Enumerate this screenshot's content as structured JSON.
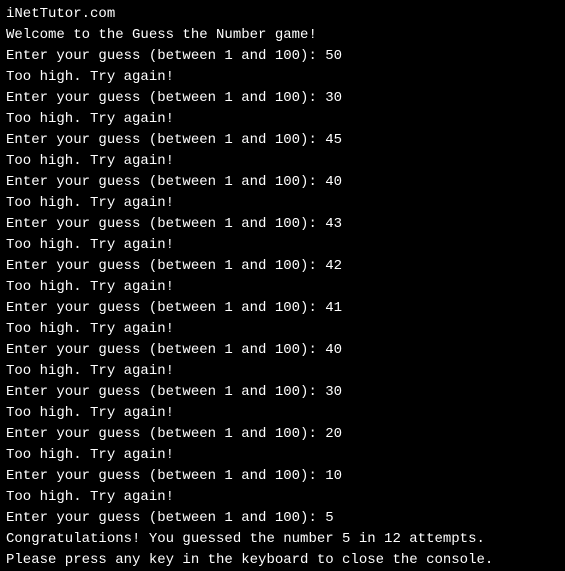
{
  "console": {
    "header": "iNetTutor.com",
    "welcome": "Welcome to the Guess the Number game!",
    "prompt_prefix": "Enter your guess (between 1 and 100): ",
    "feedback_high": "Too high. Try again!",
    "attempts": [
      {
        "guess": "50",
        "feedback": "Too high. Try again!"
      },
      {
        "guess": "30",
        "feedback": "Too high. Try again!"
      },
      {
        "guess": "45",
        "feedback": "Too high. Try again!"
      },
      {
        "guess": "40",
        "feedback": "Too high. Try again!"
      },
      {
        "guess": "43",
        "feedback": "Too high. Try again!"
      },
      {
        "guess": "42",
        "feedback": "Too high. Try again!"
      },
      {
        "guess": "41",
        "feedback": "Too high. Try again!"
      },
      {
        "guess": "40",
        "feedback": "Too high. Try again!"
      },
      {
        "guess": "30",
        "feedback": "Too high. Try again!"
      },
      {
        "guess": "20",
        "feedback": "Too high. Try again!"
      },
      {
        "guess": "10",
        "feedback": "Too high. Try again!"
      }
    ],
    "final_prompt": "Enter your guess (between 1 and 100): 5",
    "congrats": "Congratulations! You guessed the number 5 in 12 attempts.",
    "close_prompt": "Please press any key in the keyboard to close the console."
  }
}
